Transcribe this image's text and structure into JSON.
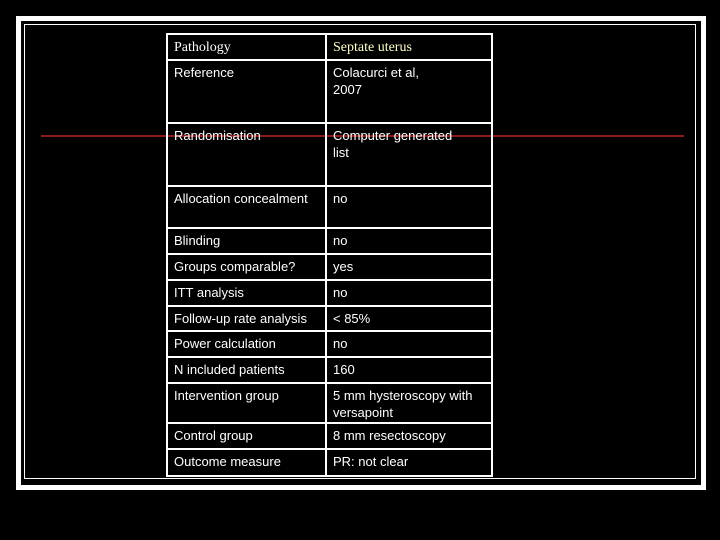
{
  "slide": {
    "table": {
      "header": {
        "label": "Pathology",
        "value": "Septate uterus"
      },
      "rows": [
        {
          "label": "Reference",
          "value": "Colacurci et al,\n2007"
        },
        {
          "label": "Randomisation",
          "value": "Computer generated\nlist"
        },
        {
          "label": "Allocation concealment",
          "value": "no"
        },
        {
          "label": "Blinding",
          "value": "no"
        },
        {
          "label": "Groups comparable?",
          "value": "yes"
        },
        {
          "label": "ITT analysis",
          "value": "no"
        },
        {
          "label": "Follow-up rate analysis",
          "value": "< 85%"
        },
        {
          "label": "Power calculation",
          "value": "no"
        },
        {
          "label": "N included patients",
          "value": "160"
        },
        {
          "label": "Intervention group",
          "value": "5 mm hysteroscopy with versapoint"
        },
        {
          "label": "Control group",
          "value": "8 mm resectoscopy"
        },
        {
          "label": "Outcome measure",
          "value": "PR: not clear"
        }
      ]
    },
    "colors": {
      "background": "#000000",
      "text": "#ffffff",
      "header_value": "#ffffcc",
      "rule": "#8b1a1a"
    }
  }
}
